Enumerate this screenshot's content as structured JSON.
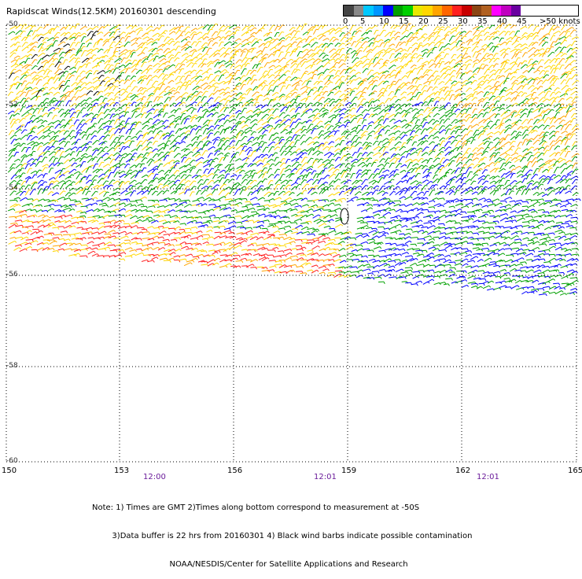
{
  "title": "Rapidscat Winds(12.5KM) 20160301 descending",
  "legend": {
    "colors": [
      "#444444",
      "#888888",
      "#00c8ff",
      "#0096ff",
      "#0000ff",
      "#00a000",
      "#00d000",
      "#e8e800",
      "#ffd700",
      "#ffa500",
      "#ff6600",
      "#ff2020",
      "#c80000",
      "#8b4513",
      "#b06020",
      "#ff00ff",
      "#c000c0",
      "#6a00a0"
    ],
    "tick_labels": [
      "0",
      "5",
      "10",
      "15",
      "20",
      "25",
      "30",
      "35",
      "40",
      "45",
      ">50 knots"
    ]
  },
  "axes": {
    "lat_labels": [
      "-50",
      "-52",
      "-54",
      "-56",
      "-58",
      "-60"
    ],
    "lon_labels": [
      "150",
      "153",
      "156",
      "159",
      "162",
      "165"
    ],
    "time_labels": [
      "12:00",
      "12:01",
      "12:01"
    ]
  },
  "notes": [
    "Note: 1) Times are GMT 2)Times along bottom correspond to measurement at -50S",
    "        3)Data buffer is 22 hrs from 20160301 4) Black wind barbs indicate possible contamination",
    "                               NOAA/NESDIS/Center for Satellite Applications and Research"
  ],
  "wind_speed_colors": {
    "5-10": "#0000ff",
    "10-15": "#00a000",
    "15-20": "#ffd700",
    "20-30": "#ffa500",
    "30-35": "#ff2020",
    "contaminated": "#000000"
  }
}
